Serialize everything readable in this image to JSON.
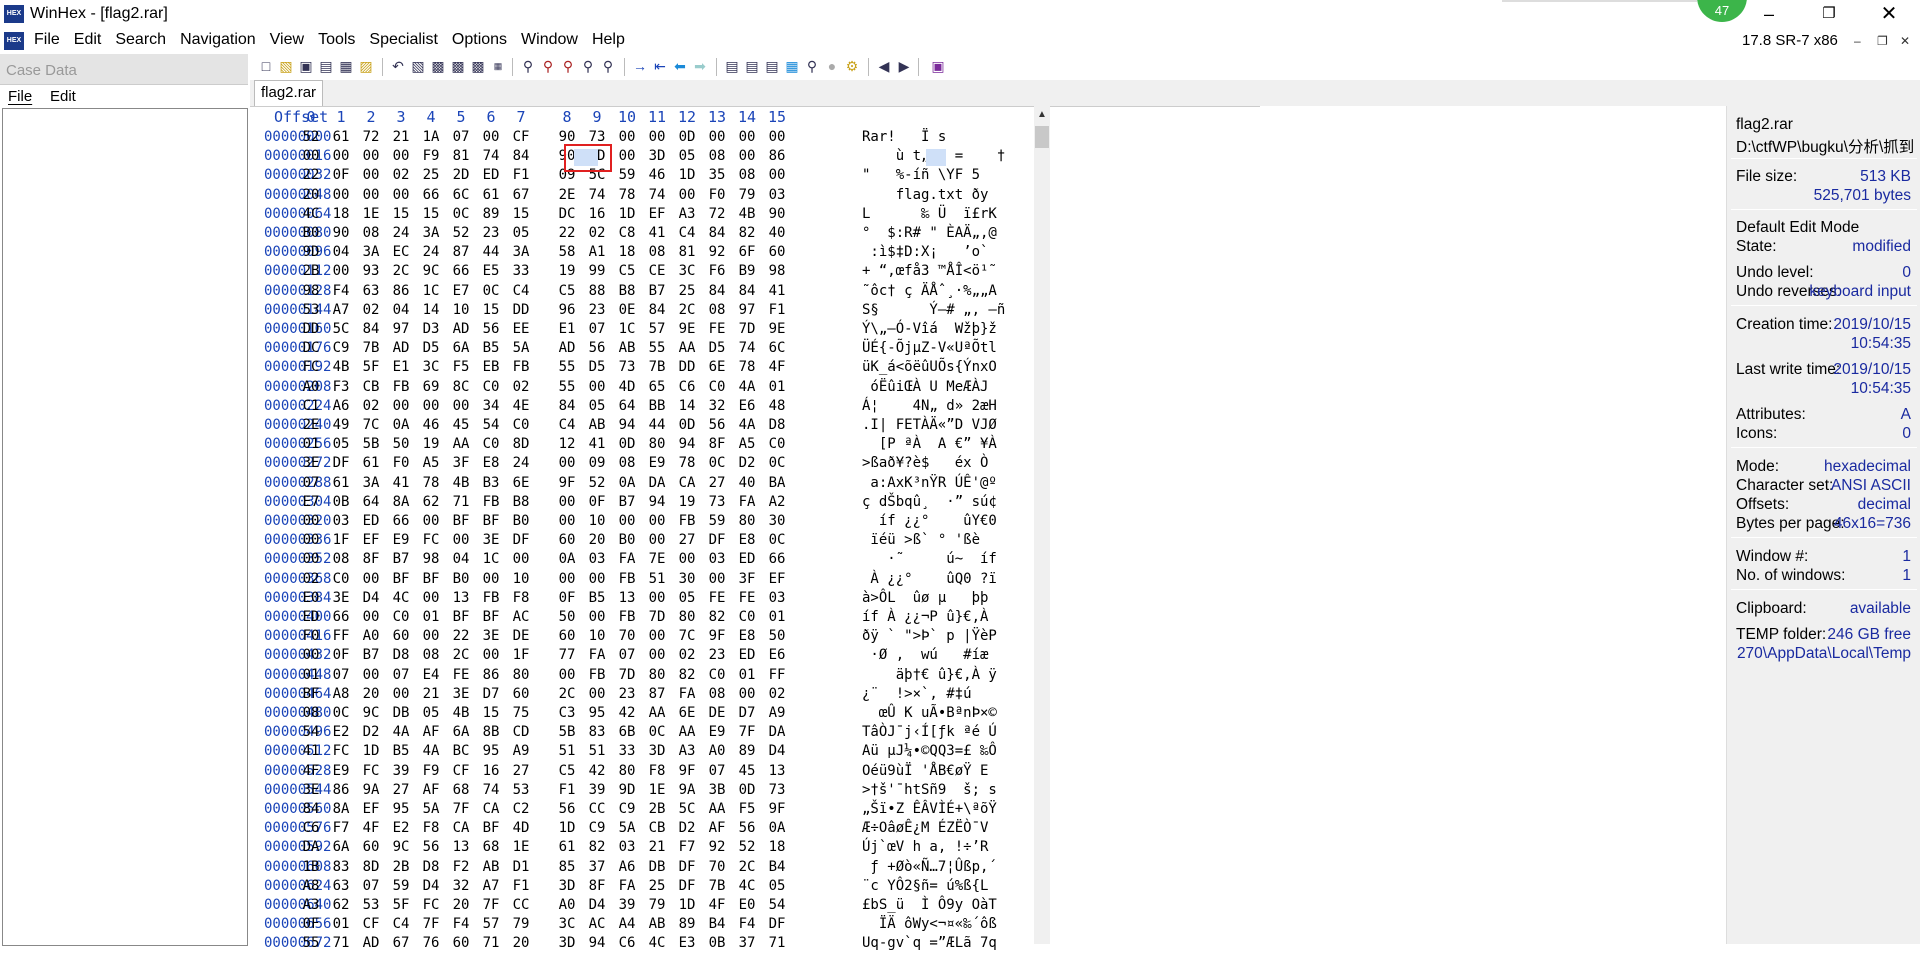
{
  "window": {
    "title": "WinHex - [flag2.rar]",
    "app_icon": "HEX",
    "badge": "47"
  },
  "menu": {
    "items": [
      "File",
      "Edit",
      "Search",
      "Navigation",
      "View",
      "Tools",
      "Specialist",
      "Options",
      "Window",
      "Help"
    ],
    "version": "17.8 SR-7 x86"
  },
  "case_panel": {
    "title": "Case Data",
    "file": "File",
    "edit": "Edit"
  },
  "tab": {
    "label": "flag2.rar"
  },
  "hex": {
    "offset_header": "Offset",
    "columns": [
      "0",
      "1",
      "2",
      "3",
      "4",
      "5",
      "6",
      "7",
      "8",
      "9",
      "10",
      "11",
      "12",
      "13",
      "14",
      "15"
    ],
    "rows": [
      {
        "o": "00000000",
        "h": "52 61 72 21 1A 07 00 CF 90 73 00 00 0D 00 00 00",
        "a": "Rar!   Ï s"
      },
      {
        "o": "00000016",
        "h": "00 00 00 00 F9 81 74 84 90 2D 00 3D 05 08 00 86",
        "a": "    ù t„ - =    †"
      },
      {
        "o": "00000032",
        "h": "22 0F 00 02 25 2D ED F1 09 5C 59 46 1D 35 08 00",
        "a": "\"   %-íñ \\YF 5"
      },
      {
        "o": "00000048",
        "h": "20 00 00 00 66 6C 61 67 2E 74 78 74 00 F0 79 03",
        "a": "    flag.txt ðy"
      },
      {
        "o": "00000064",
        "h": "4C 18 1E 15 15 0C 89 15 DC 16 1D EF A3 72 4B 90",
        "a": "L      ‰ Ü  ï£rK"
      },
      {
        "o": "00000080",
        "h": "B0 90 08 24 3A 52 23 05 22 02 C8 41 C4 84 82 40",
        "a": "°  $:R# \" ÈAÄ„‚@"
      },
      {
        "o": "00000096",
        "h": "9D 04 3A EC 24 87 44 3A 58 A1 18 08 81 92 6F 60",
        "a": " :ì$‡D:X¡   ’o`"
      },
      {
        "o": "00000112",
        "h": "2B 00 93 2C 9C 66 E5 33 19 99 C5 CE 3C F6 B9 98",
        "a": "+ “,œfå3 ™ÅÎ<ö¹˜"
      },
      {
        "o": "00000128",
        "h": "98 F4 63 86 1C E7 0C C4 C5 88 B8 B7 25 84 84 41",
        "a": "˜ôc† ç ÄÅˆ¸·%„„A"
      },
      {
        "o": "00000144",
        "h": "53 A7 02 04 14 10 15 DD 96 23 0E 84 2C 08 97 F1",
        "a": "S§      Ý–# „, —ñ"
      },
      {
        "o": "00000160",
        "h": "DD 5C 84 97 D3 AD 56 EE E1 07 1C 57 9E FE 7D 9E",
        "a": "Ý\\„—Ó-Vîá  Wžþ}ž"
      },
      {
        "o": "00000176",
        "h": "DC C9 7B AD D5 6A B5 5A AD 56 AB 55 AA D5 74 6C",
        "a": "ÜÉ{-ÕjµZ-V«UªÕtl"
      },
      {
        "o": "00000192",
        "h": "FC 4B 5F E1 3C F5 EB FB 55 D5 73 7B DD 6E 78 4F",
        "a": "üK_á<õëûUÕs{ÝnxO"
      },
      {
        "o": "00000208",
        "h": "A0 F3 CB FB 69 8C C0 02 55 00 4D 65 C6 C0 4A 01",
        "a": " óËûiŒÀ U MeÆÀJ"
      },
      {
        "o": "00000224",
        "h": "C1 A6 02 00 00 00 34 4E 84 05 64 BB 14 32 E6 48",
        "a": "Á¦    4N„ d» 2æH"
      },
      {
        "o": "00000240",
        "h": "2E 49 7C 0A 46 45 54 C0 C4 AB 94 44 0D 56 4A D8",
        "a": ".I| FETÀÄ«”D VJØ"
      },
      {
        "o": "00000256",
        "h": "01 05 5B 50 19 AA C0 8D 12 41 0D 80 94 8F A5 C0",
        "a": "  [P ªÀ  A €” ¥À"
      },
      {
        "o": "00000272",
        "h": "3E DF 61 F0 A5 3F E8 24 00 09 08 E9 78 0C D2 0C",
        "a": ">ßað¥?è$   éx Ò"
      },
      {
        "o": "00000288",
        "h": "07 61 3A 41 78 4B B3 6E 9F 52 0A DA CA 27 40 BA",
        "a": " a:AxK³nŸR ÚÊ'@º"
      },
      {
        "o": "00000304",
        "h": "E7 0B 64 8A 62 71 FB B8 00 0F B7 94 19 73 FA A2",
        "a": "ç dŠbqû¸  ·” sú¢"
      },
      {
        "o": "00000320",
        "h": "00 03 ED 66 00 BF BF B0 00 10 00 00 FB 59 80 30",
        "a": "  íf ¿¿°    ûY€0"
      },
      {
        "o": "00000336",
        "h": "00 1F EF E9 FC 00 3E DF 60 20 B0 00 27 DF E8 0C",
        "a": " ïéü >ß` ° 'ßè"
      },
      {
        "o": "00000352",
        "h": "00 08 8F B7 98 04 1C 00 0A 03 FA 7E 00 03 ED 66",
        "a": "   ·˜     ú~  íf"
      },
      {
        "o": "00000368",
        "h": "02 C0 00 BF BF B0 00 10 00 00 FB 51 30 00 3F EF",
        "a": " À ¿¿°    ûQ0 ?ï"
      },
      {
        "o": "00000384",
        "h": "E0 3E D4 4C 00 13 FB F8 0F B5 13 00 05 FE FE 03",
        "a": "à>ÔL  ûø µ   þþ"
      },
      {
        "o": "00000400",
        "h": "ED 66 00 C0 01 BF BF AC 50 00 FB 7D 80 82 C0 01",
        "a": "íf À ¿¿¬P û}€‚À"
      },
      {
        "o": "00000416",
        "h": "F0 FF A0 60 00 22 3E DE 60 10 70 00 7C 9F E8 50",
        "a": "ðÿ ` \">Þ` p |ŸèP"
      },
      {
        "o": "00000432",
        "h": "00 0F B7 D8 08 2C 00 1F 77 FA 07 00 02 23 ED E6",
        "a": " ·Ø ,  wú   #íæ"
      },
      {
        "o": "00000448",
        "h": "01 07 00 07 E4 FE 86 80 00 FB 7D 80 82 C0 01 FF",
        "a": "    äþ†€ û}€‚À ÿ"
      },
      {
        "o": "00000464",
        "h": "BF A8 20 00 21 3E D7 60 2C 00 23 87 FA 08 00 02",
        "a": "¿¨  !>×`, #‡ú"
      },
      {
        "o": "00000480",
        "h": "08 0C 9C DB 05 4B 15 75 C3 95 42 AA 6E DE D7 A9",
        "a": "  œÛ K uÃ•BªnÞ×©"
      },
      {
        "o": "00000496",
        "h": "54 E2 D2 4A AF 6A 8B CD 5B 83 6B 0C AA E9 7F DA",
        "a": "TâÒJ¯j‹Í[ƒk ªé Ú"
      },
      {
        "o": "00000512",
        "h": "41 FC 1D B5 4A BC 95 A9 51 51 33 3D A3 A0 89 D4",
        "a": "Aü µJ¼•©QQ3=£ ‰Ô"
      },
      {
        "o": "00000528",
        "h": "4F E9 FC 39 F9 CF 16 27 C5 42 80 F8 9F 07 45 13",
        "a": "Oéü9ùÏ 'ÅB€øŸ E"
      },
      {
        "o": "00000544",
        "h": "3E 86 9A 27 AF 68 74 53 F1 39 9D 1E 9A 3B 0D 73",
        "a": ">†š'¯htSñ9  š; s"
      },
      {
        "o": "00000560",
        "h": "84 8A EF 95 5A 7F CA C2 56 CC C9 2B 5C AA F5 9F",
        "a": "„Šï•Z ÊÂVÌÉ+\\ªõŸ"
      },
      {
        "o": "00000576",
        "h": "C6 F7 4F E2 F8 CA BF 4D 1D C9 5A CB D2 AF 56 0A",
        "a": "Æ÷OâøÊ¿M ÉZËÒ¯V"
      },
      {
        "o": "00000592",
        "h": "DA 6A 60 9C 56 13 68 1E 61 82 03 21 F7 92 52 18",
        "a": "Új`œV h a‚ !÷’R"
      },
      {
        "o": "00000608",
        "h": "1B 83 8D 2B D8 F2 AB D1 85 37 A6 DB DF 70 2C B4",
        "a": " ƒ +Øò«Ñ…7¦Ûßp,´"
      },
      {
        "o": "00000624",
        "h": "A8 63 07 59 D4 32 A7 F1 3D 8F FA 25 DF 7B 4C 05",
        "a": "¨c YÔ2§ñ= ú%ß{L"
      },
      {
        "o": "00000640",
        "h": "A3 62 53 5F FC 20 7F CC A0 D4 39 79 1D 4F E0 54",
        "a": "£bS_ü  Ì Ô9y OàT"
      },
      {
        "o": "00000656",
        "h": "0F 01 CF C4 7F F4 57 79 3C AC A4 AB 89 B4 F4 DF",
        "a": "  ÏÄ ôWy<¬¤«‰´ôß"
      },
      {
        "o": "00000672",
        "h": "55 71 AD 67 76 60 71 20 3D 94 C6 4C E3 0B 37 71",
        "a": "Uq-gv`q =”ÆLã 7q"
      }
    ]
  },
  "info": {
    "file_name": "flag2.rar",
    "file_path": "D:\\ctfWP\\bugku\\分析\\抓到",
    "file_size_label": "File size:",
    "file_size_kb": "513 KB",
    "file_size_bytes": "525,701 bytes",
    "edit_mode": "Default Edit Mode",
    "state_label": "State:",
    "state": "modified",
    "undo_level_label": "Undo level:",
    "undo_level": "0",
    "undo_reverses_label": "Undo reverses:",
    "undo_reverses": "keyboard input",
    "creation_label": "Creation time:",
    "creation_date": "2019/10/15",
    "creation_time": "10:54:35",
    "lastwrite_label": "Last write time:",
    "lastwrite_date": "2019/10/15",
    "lastwrite_time": "10:54:35",
    "attributes_label": "Attributes:",
    "attributes": "A",
    "icons_label": "Icons:",
    "icons": "0",
    "mode_label": "Mode:",
    "mode": "hexadecimal",
    "charset_label": "Character set:",
    "charset": "ANSI ASCII",
    "offsets_label": "Offsets:",
    "offsets": "decimal",
    "bpp_label": "Bytes per page:",
    "bpp": "46x16=736",
    "window_no_label": "Window #:",
    "window_no": "1",
    "no_windows_label": "No. of windows:",
    "no_windows": "1",
    "clipboard_label": "Clipboard:",
    "clipboard": "available",
    "temp_label": "TEMP folder:",
    "temp_free": "246 GB free",
    "temp_path": "270\\AppData\\Local\\Temp"
  },
  "colors": {
    "accent": "#1a44b8",
    "selection": "#e02020",
    "highlight": "#cfe0f8"
  }
}
